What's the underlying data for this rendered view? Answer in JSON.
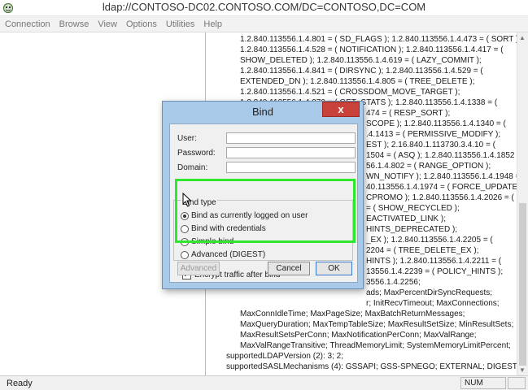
{
  "window": {
    "title": "ldap://CONTOSO-DC02.CONTOSO.COM/DC=CONTOSO,DC=COM",
    "app_icon": "ldp-app-icon"
  },
  "menu": [
    "Connection",
    "Browse",
    "View",
    "Options",
    "Utilities",
    "Help"
  ],
  "output_lines": [
    "1.2.840.113556.1.4.801 = ( SD_FLAGS ); 1.2.840.113556.1.4.473 = ( SORT );",
    "1.2.840.113556.1.4.528 = ( NOTIFICATION ); 1.2.840.113556.1.4.417 = (",
    "SHOW_DELETED ); 1.2.840.113556.1.4.619 = ( LAZY_COMMIT );",
    "1.2.840.113556.1.4.841 = ( DIRSYNC ); 1.2.840.113556.1.4.529 = (",
    "EXTENDED_DN ); 1.2.840.113556.1.4.805 = ( TREE_DELETE );",
    "1.2.840.113556.1.4.521 = ( CROSSDOM_MOVE_TARGET );",
    "1.2.840.113556.1.4.970 = ( GET_STATS ); 1.2.840.113556.1.4.1338 = (",
    "474 = ( RESP_SORT );",
    "SCOPE ); 1.2.840.113556.1.4.1340 = (",
    ".4.1413 = ( PERMISSIVE_MODIFY );",
    "EST ); 2.16.840.1.113730.3.4.10 = (",
    "1504 = ( ASQ ); 1.2.840.113556.1.4.1852",
    "56.1.4.802 = ( RANGE_OPTION );",
    "WN_NOTIFY ); 1.2.840.113556.1.4.1948 =",
    "40.113556.1.4.1974 = ( FORCE_UPDATE );",
    "CPROMO ); 1.2.840.113556.1.4.2026 = (",
    "= ( SHOW_RECYCLED );",
    "EACTIVATED_LINK );",
    "HINTS_DEPRECATED );",
    "_EX ); 1.2.840.113556.1.4.2205 = (",
    "2204 = ( TREE_DELETE_EX );",
    "HINTS ); 1.2.840.113556.1.4.2211 = (",
    "13556.1.4.2239 = ( POLICY_HINTS );",
    "3556.1.4.2256;",
    "ads; MaxPercentDirSyncRequests;",
    "r; InitRecvTimeout; MaxConnections;",
    "MaxConnIdleTime; MaxPageSize; MaxBatchReturnMessages;",
    "MaxQueryDuration; MaxTempTableSize; MaxResultSetSize; MinResultSets;",
    "MaxResultSetsPerConn; MaxNotificationPerConn; MaxValRange;",
    "MaxValRangeTransitive; ThreadMemoryLimit; SystemMemoryLimitPercent;",
    "supportedLDAPVersion (2): 3; 2;",
    "supportedSASLMechanisms (4): GSSAPI; GSS-SPNEGO; EXTERNAL; DIGEST-MD5;",
    "",
    "-----------"
  ],
  "status": {
    "ready": "Ready",
    "num": "NUM"
  },
  "dialog": {
    "title": "Bind",
    "close_label": "x",
    "user_label": "User:",
    "user_value": "",
    "password_label": "Password:",
    "password_value": "",
    "domain_label": "Domain:",
    "domain_value": "",
    "bind_type_label": "Bind type",
    "options": [
      {
        "label": "Bind as currently logged on user",
        "checked": true
      },
      {
        "label": "Bind with credentials",
        "checked": false
      },
      {
        "label": "Simple bind",
        "checked": false
      },
      {
        "label": "Advanced (DIGEST)",
        "checked": false
      }
    ],
    "encrypt_label": "Encrypt traffic after bind",
    "encrypt_checked": true,
    "check_mark": "✓",
    "advanced_button": "Advanced",
    "cancel_button": "Cancel",
    "ok_button": "OK"
  },
  "colors": {
    "highlight": "#2ee82e",
    "dialog_frame": "#a8c9e8",
    "close_button": "#c8413a"
  }
}
